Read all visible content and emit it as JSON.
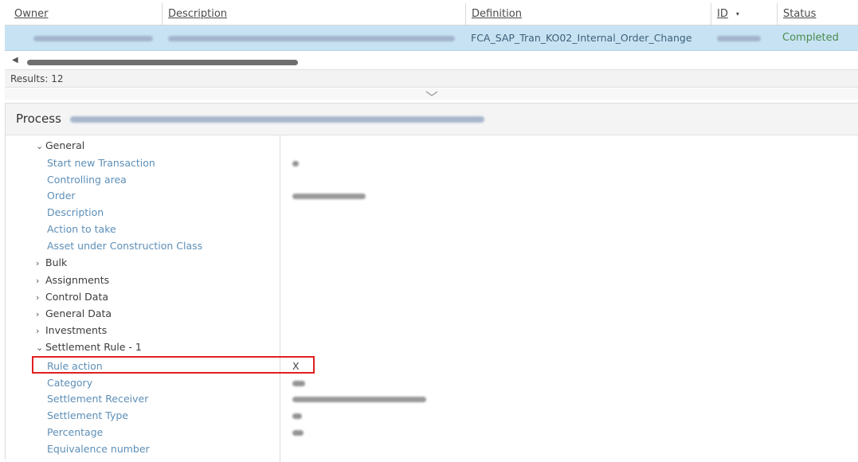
{
  "table": {
    "columns": [
      {
        "label": "Owner"
      },
      {
        "label": "Description"
      },
      {
        "label": "Definition"
      },
      {
        "label": "ID"
      },
      {
        "label": "Status"
      }
    ],
    "id_sort_icon": "▾",
    "row": {
      "definition": "FCA_SAP_Tran_KO02_Internal_Order_Change",
      "status": "Completed"
    }
  },
  "results_label": "Results: 12",
  "process": {
    "title": "Process"
  },
  "tree": {
    "general": {
      "label": "General",
      "chev": "v"
    },
    "start_new_transaction": "Start new Transaction",
    "controlling_area": "Controlling area",
    "order": "Order",
    "description": "Description",
    "action_to_take": "Action to take",
    "asset_class": "Asset under Construction Class",
    "bulk": {
      "label": "Bulk",
      "chev": ">"
    },
    "assignments": {
      "label": "Assignments",
      "chev": ">"
    },
    "control_data": {
      "label": "Control Data",
      "chev": ">"
    },
    "general_data": {
      "label": "General Data",
      "chev": ">"
    },
    "investments": {
      "label": "Investments",
      "chev": ">"
    },
    "settlement_rule": {
      "label": "Settlement Rule - 1",
      "chev": "v"
    },
    "rule_action": "Rule action",
    "category": "Category",
    "settlement_receiver": "Settlement Receiver",
    "settlement_type": "Settlement Type",
    "percentage": "Percentage",
    "equivalence_number": "Equivalence number"
  },
  "values": {
    "rule_action": "X"
  },
  "colors": {
    "selected_row": "#c7e3f3",
    "leaf_label": "#5d8fb8",
    "status_completed": "#4d8a4d",
    "highlight_box": "#e02020"
  }
}
